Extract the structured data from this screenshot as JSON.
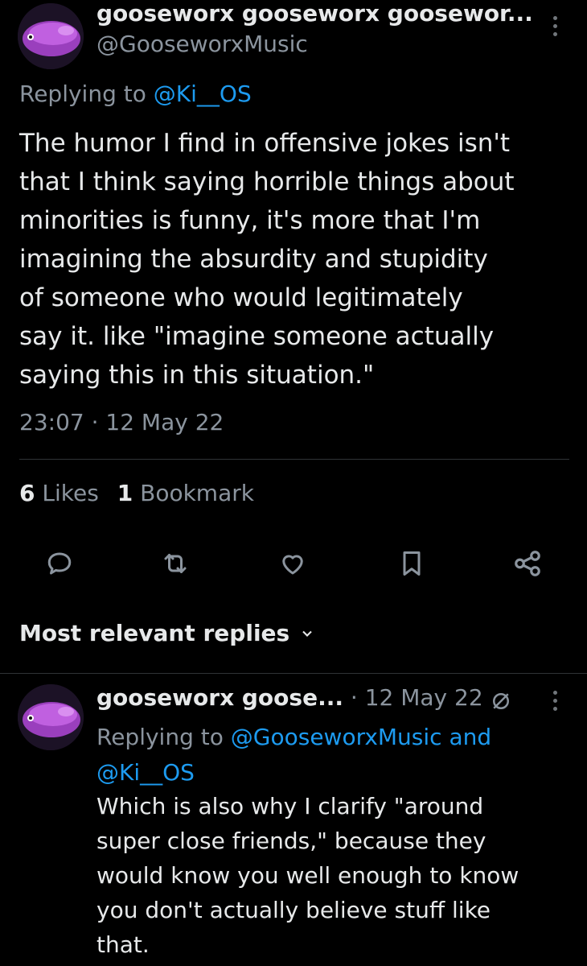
{
  "tweet": {
    "display_name": "gooseworx gooseworx goosewor...",
    "handle": "@GooseworxMusic",
    "replying_prefix": "Replying to",
    "replying_to": "@Ki__OS",
    "text_lines": [
      "The humor I find in offensive jokes isn't",
      "that I think saying horrible things about",
      "minorities is funny, it's more that I'm",
      "imagining the absurdity and stupidity",
      "of someone who would legitimately",
      "say it. like \"imagine someone actually",
      "saying this in this situation.\""
    ],
    "timestamp": "23:07 · 12 May 22",
    "likes_count": "6",
    "likes_label": "Likes",
    "bookmarks_count": "1",
    "bookmarks_label": "Bookmark"
  },
  "actions": {
    "icons": [
      "reply-icon",
      "retweet-icon",
      "like-icon",
      "bookmark-icon",
      "share-icon"
    ]
  },
  "replies_section": {
    "sort_label": "Most relevant replies"
  },
  "reply": {
    "display_name": "gooseworx goose...",
    "date": "· 12 May 22",
    "replying_prefix": "Replying to",
    "replying_to_first": "@GooseworxMusic",
    "replying_joiner": "and",
    "replying_to_second": "@Ki__OS",
    "text_lines": [
      "Which is also why I clarify \"around",
      "super close friends,\" because they",
      "would know you well enough to know",
      "you don't actually believe stuff like",
      "that."
    ]
  },
  "colors": {
    "background": "#000000",
    "text": "#e7e9ea",
    "muted": "#8b949e",
    "link": "#1d9bf0",
    "divider": "#2f3336",
    "avatar_purple": "#b24fd0"
  }
}
